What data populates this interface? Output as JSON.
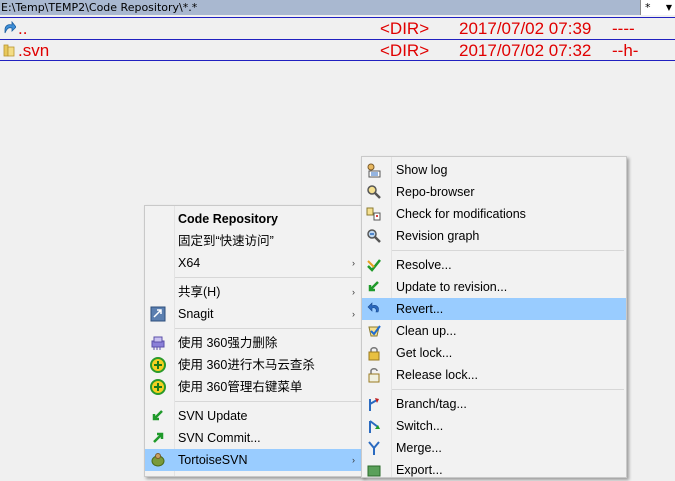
{
  "path_bar": {
    "path": "E:\\Temp\\TEMP2\\Code Repository\\*.*"
  },
  "filter": {
    "star": "*",
    "arrow": "▼"
  },
  "files": [
    {
      "name": "..",
      "ext": "<DIR>",
      "date": "2017/07/02 07:39",
      "attr": "----",
      "icon": "up-arrow-icon"
    },
    {
      "name": ".svn",
      "ext": "<DIR>",
      "date": "2017/07/02 07:32",
      "attr": "--h-",
      "icon": "folder-icon"
    }
  ],
  "context_menu": {
    "items": [
      {
        "label": "Code Repository"
      },
      {
        "label": "固定到“快速访问”"
      },
      {
        "label": "X64",
        "submenu": "›"
      },
      {
        "label": "共享(H)",
        "submenu": "›"
      },
      {
        "label": "Snagit",
        "submenu": "›",
        "icon": "snagit-icon"
      },
      {
        "label": "使用 360强力删除",
        "icon": "360-shred-icon"
      },
      {
        "label": "使用 360进行木马云查杀",
        "icon": "360-scan-icon"
      },
      {
        "label": "使用 360管理右键菜单",
        "icon": "360-menu-icon"
      },
      {
        "label": "SVN Update",
        "icon": "svn-update-icon"
      },
      {
        "label": "SVN Commit...",
        "icon": "svn-commit-icon"
      },
      {
        "label": "TortoiseSVN",
        "submenu": "›",
        "icon": "tortoisesvn-icon"
      }
    ]
  },
  "svn_submenu": {
    "items": [
      {
        "label": "Show log",
        "icon": "show-log-icon"
      },
      {
        "label": "Repo-browser",
        "icon": "repo-browser-icon"
      },
      {
        "label": "Check for modifications",
        "icon": "check-modifications-icon"
      },
      {
        "label": "Revision graph",
        "icon": "revision-graph-icon"
      },
      {
        "label": "Resolve...",
        "icon": "resolve-icon"
      },
      {
        "label": "Update to revision...",
        "icon": "update-revision-icon"
      },
      {
        "label": "Revert...",
        "icon": "revert-icon"
      },
      {
        "label": "Clean up...",
        "icon": "cleanup-icon"
      },
      {
        "label": "Get lock...",
        "icon": "lock-icon"
      },
      {
        "label": "Release lock...",
        "icon": "unlock-icon"
      },
      {
        "label": "Branch/tag...",
        "icon": "branch-icon"
      },
      {
        "label": "Switch...",
        "icon": "switch-icon"
      },
      {
        "label": "Merge...",
        "icon": "merge-icon"
      },
      {
        "label": "Export...",
        "icon": "export-icon"
      }
    ]
  },
  "colors": {
    "highlight": "#99ccff",
    "file_text": "#e00000",
    "path_bar": "#a9b8d0"
  }
}
